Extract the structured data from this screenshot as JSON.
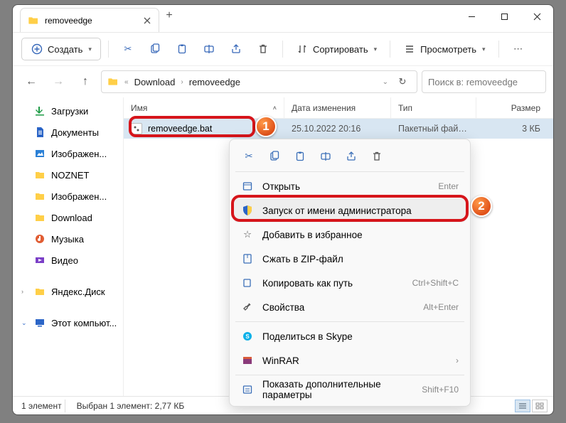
{
  "tab": {
    "title": "removeedge"
  },
  "toolbar": {
    "create": "Создать",
    "sort": "Сортировать",
    "view": "Просмотреть"
  },
  "breadcrumb": {
    "a": "Download",
    "b": "removeedge"
  },
  "search": {
    "placeholder": "Поиск в: removeedge"
  },
  "columns": {
    "name": "Имя",
    "date": "Дата изменения",
    "type": "Тип",
    "size": "Размер"
  },
  "sidebar": {
    "items": [
      {
        "label": "Загрузки"
      },
      {
        "label": "Документы"
      },
      {
        "label": "Изображен..."
      },
      {
        "label": "NOZNET"
      },
      {
        "label": "Изображен..."
      },
      {
        "label": "Download"
      },
      {
        "label": "Музыка"
      },
      {
        "label": "Видео"
      },
      {
        "label": "Яндекс.Диск"
      },
      {
        "label": "Этот компьют..."
      }
    ]
  },
  "file": {
    "name": "removeedge.bat",
    "date": "25.10.2022 20:16",
    "type": "Пакетный файл ...",
    "size": "3 КБ"
  },
  "ctx": {
    "open": "Открыть",
    "open_sc": "Enter",
    "admin": "Запуск от имени администратора",
    "fav": "Добавить в избранное",
    "zip": "Сжать в ZIP-файл",
    "copypath": "Копировать как путь",
    "copypath_sc": "Ctrl+Shift+C",
    "props": "Свойства",
    "props_sc": "Alt+Enter",
    "skype": "Поделиться в Skype",
    "winrar": "WinRAR",
    "more": "Показать дополнительные параметры",
    "more_sc": "Shift+F10"
  },
  "status": {
    "count": "1 элемент",
    "sel": "Выбран 1 элемент: 2,77 КБ"
  },
  "badges": {
    "one": "1",
    "two": "2"
  }
}
